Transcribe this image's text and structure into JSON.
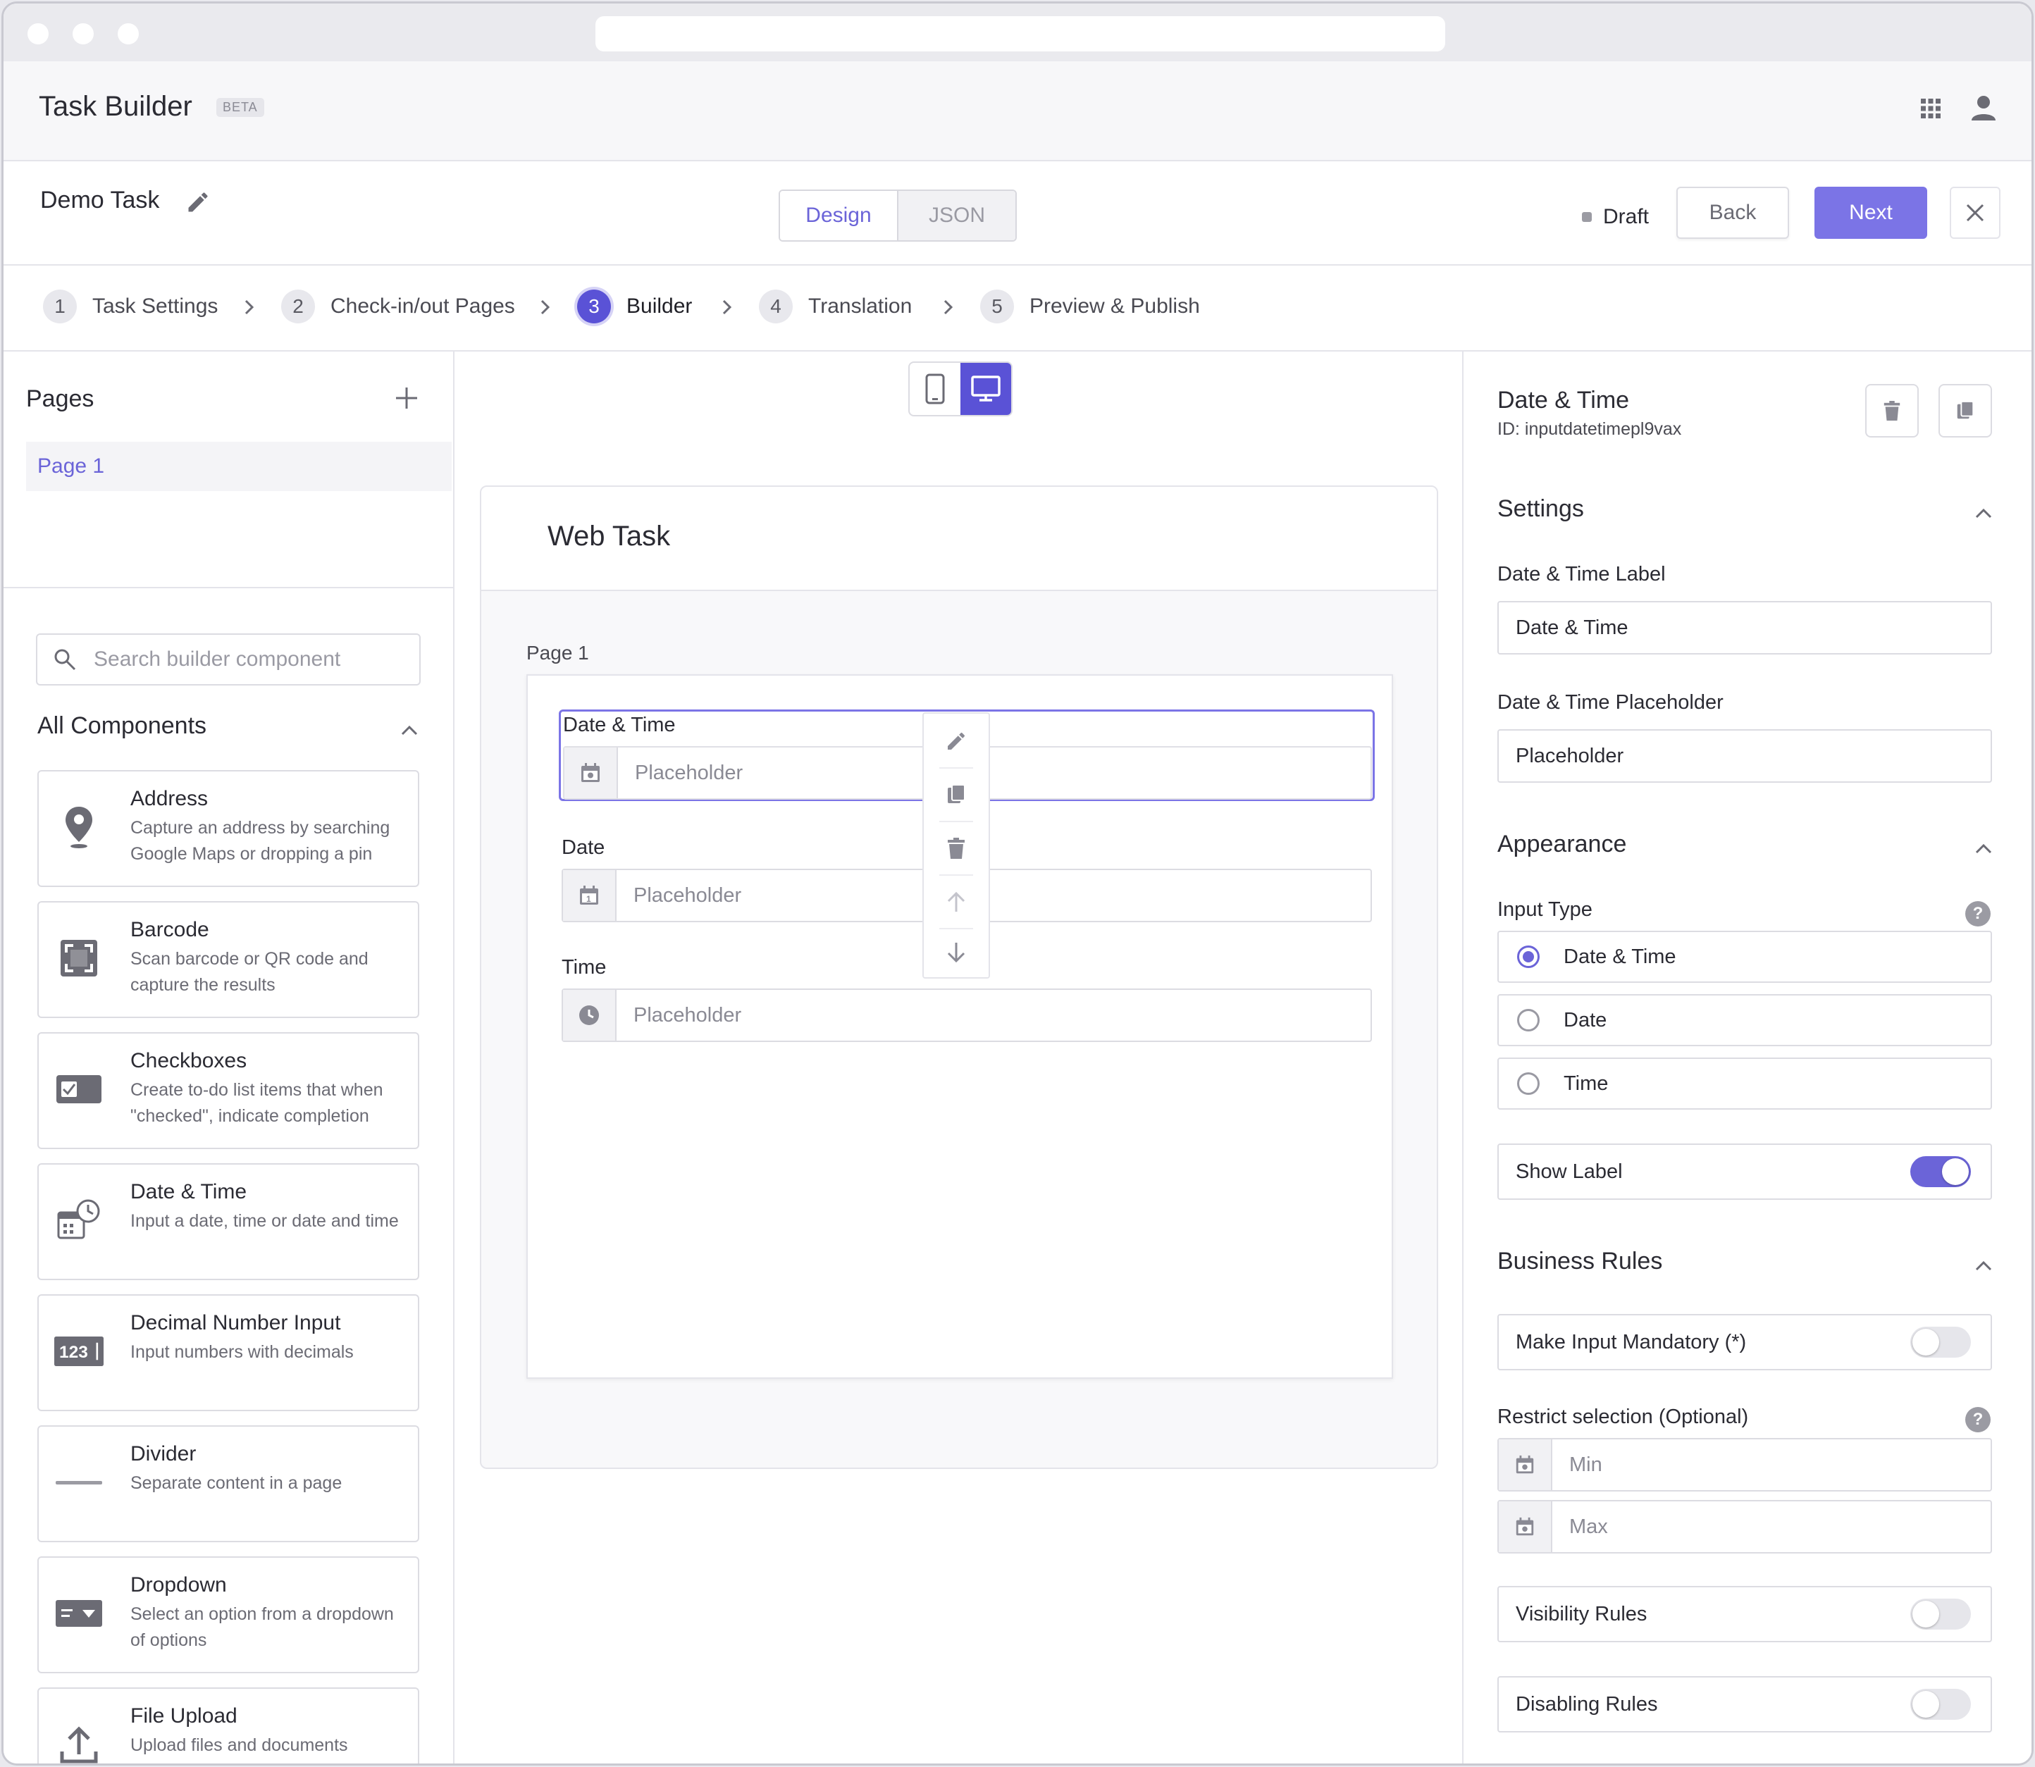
{
  "app": {
    "title": "Task Builder",
    "badge": "BETA"
  },
  "task": {
    "name": "Demo Task",
    "modes": [
      "Design",
      "JSON"
    ],
    "status": "Draft",
    "back_label": "Back",
    "next_label": "Next"
  },
  "steps": [
    {
      "num": "1",
      "label": "Task Settings"
    },
    {
      "num": "2",
      "label": "Check-in/out Pages"
    },
    {
      "num": "3",
      "label": "Builder"
    },
    {
      "num": "4",
      "label": "Translation"
    },
    {
      "num": "5",
      "label": "Preview & Publish"
    }
  ],
  "active_step": "3",
  "left": {
    "pages_title": "Pages",
    "pages": [
      "Page 1"
    ],
    "search_placeholder": "Search builder component",
    "all_components": "All Components",
    "components": [
      {
        "title": "Address",
        "desc": "Capture an address by searching Google Maps or dropping a pin",
        "icon": "map-pin-icon"
      },
      {
        "title": "Barcode",
        "desc": "Scan barcode or QR code and capture the results",
        "icon": "barcode-scan-icon"
      },
      {
        "title": "Checkboxes",
        "desc": "Create to-do list items that when \"checked\", indicate completion",
        "icon": "checkbox-icon"
      },
      {
        "title": "Date & Time",
        "desc": "Input a date, time or date and time",
        "icon": "calendar-clock-icon"
      },
      {
        "title": "Decimal Number Input",
        "desc": "Input numbers with decimals",
        "icon": "number-123-icon"
      },
      {
        "title": "Divider",
        "desc": "Separate content in a page",
        "icon": "divider-line-icon"
      },
      {
        "title": "Dropdown",
        "desc": "Select an option from a dropdown of options",
        "icon": "dropdown-icon"
      },
      {
        "title": "File Upload",
        "desc": "Upload files and documents",
        "icon": "upload-icon"
      }
    ]
  },
  "canvas": {
    "title": "Web Task",
    "page_label": "Page 1",
    "fields": [
      {
        "label": "Date & Time",
        "placeholder": "Placeholder",
        "icon": "calendar-icon"
      },
      {
        "label": "Date",
        "placeholder": "Placeholder",
        "icon": "calendar-icon"
      },
      {
        "label": "Time",
        "placeholder": "Placeholder",
        "icon": "clock-icon"
      }
    ],
    "date_icon_digit": "1"
  },
  "right": {
    "title": "Date & Time",
    "id_text": "ID: inputdatetimepl9vax",
    "settings_title": "Settings",
    "label_label": "Date & Time Label",
    "label_value": "Date & Time",
    "placeholder_label": "Date & Time Placeholder",
    "placeholder_value": "Placeholder",
    "appearance_title": "Appearance",
    "input_type_label": "Input Type",
    "input_types": [
      "Date & Time",
      "Date",
      "Time"
    ],
    "selected_input_type": "Date & Time",
    "show_label": "Show Label",
    "show_label_on": true,
    "business_rules_title": "Business Rules",
    "mandatory_label": "Make Input Mandatory (*)",
    "mandatory_on": false,
    "restrict_label": "Restrict selection (Optional)",
    "min_placeholder": "Min",
    "max_placeholder": "Max",
    "visibility_label": "Visibility Rules",
    "visibility_on": false,
    "disabling_label": "Disabling Rules",
    "disabling_on": false,
    "help_glyph": "?"
  },
  "colors": {
    "accent": "#6b64d8",
    "accent_strong": "#5a52d6",
    "next_button": "#7b74e6"
  }
}
